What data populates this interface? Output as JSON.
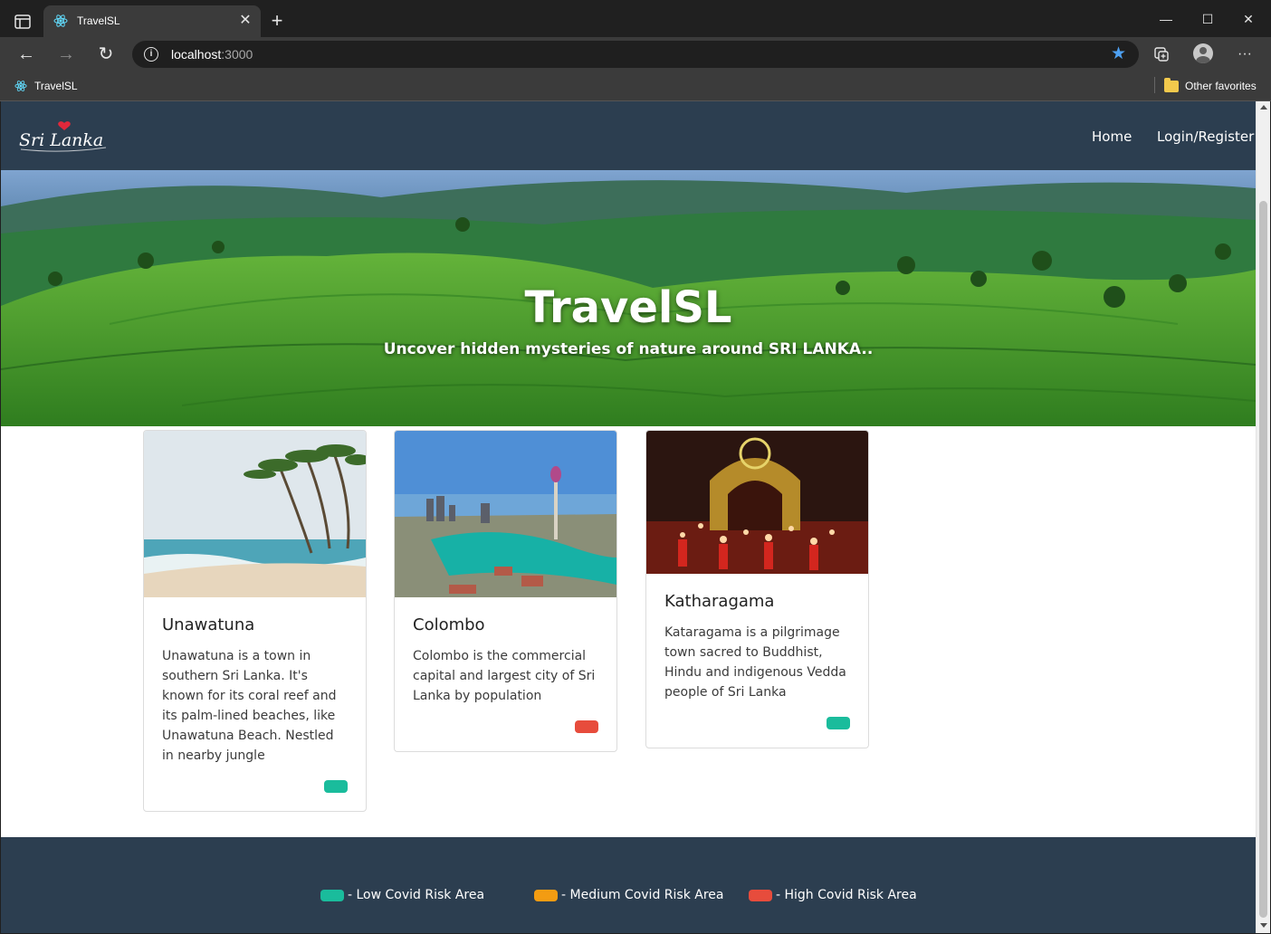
{
  "browser": {
    "tab_title": "TravelSL",
    "url_host": "localhost",
    "url_port": ":3000",
    "bookmark_label": "TravelSL",
    "other_favorites": "Other favorites"
  },
  "site": {
    "logo_text": "Sri Lanka",
    "nav": [
      {
        "label": "Home"
      },
      {
        "label": "Login/Register"
      }
    ],
    "hero": {
      "title": "TravelSL",
      "subtitle": "Uncover hidden mysteries of nature around SRI LANKA.."
    },
    "cards": [
      {
        "title": "Unawatuna",
        "text": "Unawatuna is a town in southern Sri Lanka. It's known for its coral reef and its palm-lined beaches, like Unawatuna Beach. Nestled in nearby jungle",
        "risk": "low",
        "image": "beach-palms-image"
      },
      {
        "title": "Colombo",
        "text": "Colombo is the commercial capital and largest city of Sri Lanka by population",
        "risk": "high",
        "image": "city-skyline-image"
      },
      {
        "title": "Katharagama",
        "text": "Kataragama is a pilgrimage town sacred to Buddhist, Hindu and indigenous Vedda people of Sri Lanka",
        "risk": "low",
        "image": "festival-fire-dance-image"
      }
    ],
    "legend": [
      {
        "label": "- Low Covid Risk Area",
        "color": "#1abc9c"
      },
      {
        "label": "- Medium Covid Risk Area",
        "color": "#f39c12"
      },
      {
        "label": "- High Covid Risk Area",
        "color": "#e74c3c"
      }
    ],
    "colors": {
      "navbar": "#2c3e50",
      "low": "#1abc9c",
      "medium": "#f39c12",
      "high": "#e74c3c"
    }
  }
}
